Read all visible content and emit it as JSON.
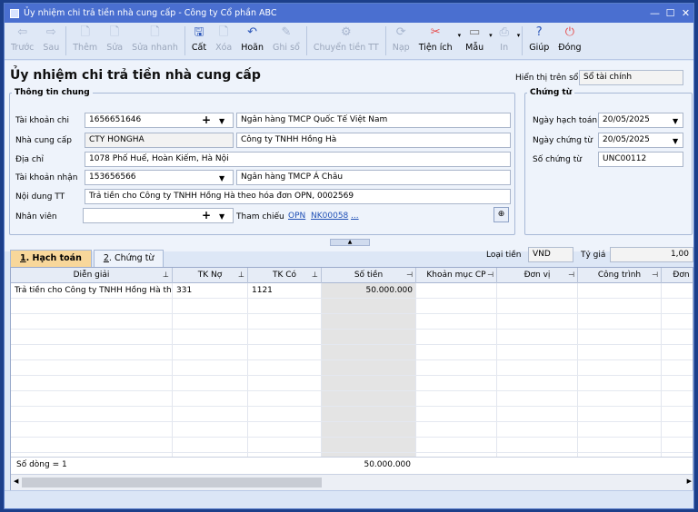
{
  "window": {
    "title": "Ủy nhiệm chi trả tiền nhà cung cấp - Công ty Cổ phần ABC",
    "minimize": "—",
    "maximize": "☐",
    "close": "✕"
  },
  "toolbar": {
    "items": [
      {
        "label": "Trước",
        "icon": "arrow-left-icon",
        "glyph": "⇦",
        "enabled": false
      },
      {
        "label": "Sau",
        "icon": "arrow-right-icon",
        "glyph": "⇨",
        "enabled": false
      },
      {
        "label": "Thêm",
        "icon": "add-icon",
        "glyph": "🗋",
        "enabled": false
      },
      {
        "label": "Sửa",
        "icon": "edit-icon",
        "glyph": "🗋",
        "enabled": false
      },
      {
        "label": "Sửa nhanh",
        "icon": "quick-edit-icon",
        "glyph": "🗋",
        "enabled": false
      },
      {
        "label": "Cất",
        "icon": "save-icon",
        "glyph": "🖫",
        "enabled": true
      },
      {
        "label": "Xóa",
        "icon": "delete-icon",
        "glyph": "🗋",
        "enabled": false
      },
      {
        "label": "Hoãn",
        "icon": "undo-icon",
        "glyph": "↶",
        "enabled": true
      },
      {
        "label": "Ghi sổ",
        "icon": "post-icon",
        "glyph": "✎",
        "enabled": false
      },
      {
        "label": "Chuyển tiền TT",
        "icon": "transfer-icon",
        "glyph": "⚙",
        "enabled": false
      },
      {
        "label": "Nạp",
        "icon": "reload-icon",
        "glyph": "⟳",
        "enabled": false
      },
      {
        "label": "Tiện ích",
        "icon": "tools-icon",
        "glyph": "✂",
        "enabled": true
      },
      {
        "label": "Mẫu",
        "icon": "template-icon",
        "glyph": "▭",
        "enabled": true
      },
      {
        "label": "In",
        "icon": "print-icon",
        "glyph": "⎙",
        "enabled": false
      },
      {
        "label": "Giúp",
        "icon": "help-icon",
        "glyph": "?",
        "enabled": true
      },
      {
        "label": "Đóng",
        "icon": "close-power-icon",
        "glyph": "⏻",
        "enabled": true
      }
    ]
  },
  "header": {
    "title": "Ủy nhiệm chi trả tiền nhà cung cấp",
    "show_on_label": "Hiển thị trên sổ",
    "show_on_value": "Sổ tài chính"
  },
  "general": {
    "legend": "Thông tin chung",
    "account_label": "Tài khoản chi",
    "account_value": "1656651646",
    "account_bank": "Ngân hàng TMCP Quốc Tế Việt Nam",
    "supplier_label": "Nhà cung cấp",
    "supplier_code": "CTY HONGHA",
    "supplier_name": "Công ty TNHH Hồng Hà",
    "address_label": "Địa chỉ",
    "address_value": "1078 Phố Huế, Hoàn Kiếm, Hà Nội",
    "recv_label": "Tài khoản nhận",
    "recv_value": "153656566",
    "recv_bank": "Ngân hàng TMCP Á Châu",
    "content_label": "Nội dung TT",
    "content_value": "Trả tiền cho Công ty TNHH Hồng Hà theo hóa đơn OPN, 0002569",
    "staff_label": "Nhân viên",
    "staff_value": "",
    "ref_label": "Tham chiếu",
    "ref_link1": "OPN",
    "ref_link2": "NK00058",
    "ref_more": "..."
  },
  "voucher": {
    "legend": "Chứng từ",
    "posting_date_label": "Ngày hạch toán",
    "posting_date": "20/05/2025",
    "voucher_date_label": "Ngày chứng từ",
    "voucher_date": "20/05/2025",
    "voucher_no_label": "Số chứng từ",
    "voucher_no": "UNC00112"
  },
  "tabs": [
    {
      "key": "1",
      "label": ". Hạch toán"
    },
    {
      "key": "2",
      "label": ". Chứng từ"
    }
  ],
  "currency": {
    "label": "Loại tiền",
    "value": "VND",
    "rate_label": "Tỷ giá",
    "rate_value": "1,00"
  },
  "grid": {
    "columns": [
      "Diễn giải",
      "TK Nợ",
      "TK Có",
      "Số tiền",
      "Khoản mục CP",
      "Đơn vị",
      "Công trình",
      "Đơn"
    ],
    "rows": [
      [
        "Trả tiền cho Công ty TNHH Hồng Hà th",
        "331",
        "1121",
        "50.000.000",
        "",
        "",
        "",
        ""
      ]
    ],
    "footer_count": "Số dòng = 1",
    "footer_total": "50.000.000"
  }
}
